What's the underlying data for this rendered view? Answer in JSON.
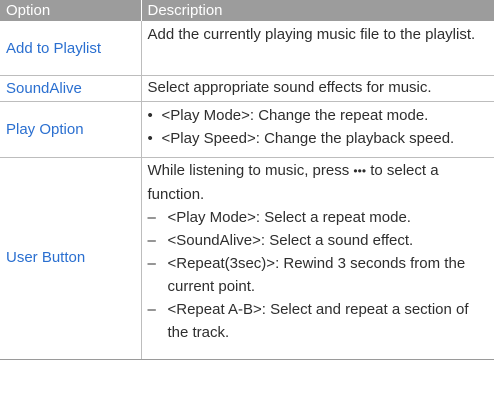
{
  "header": {
    "option": "Option",
    "description": "Description"
  },
  "rows": [
    {
      "option": "Add to Playlist",
      "description": "Add the currently playing music file to the playlist."
    },
    {
      "option": "SoundAlive",
      "description": "Select appropriate sound effects for music."
    },
    {
      "option": "Play Option",
      "bullets": [
        "<Play Mode>: Change the repeat mode.",
        "<Play Speed>: Change the playback speed."
      ]
    },
    {
      "option": "User Button",
      "intro_before_icon": "While listening to music, press",
      "icon_glyph": "•••",
      "intro_after_icon": "to select a function.",
      "dashes": [
        "<Play Mode>: Select a repeat mode.",
        "<SoundAlive>: Select a sound effect.",
        "<Repeat(3sec)>: Rewind 3 seconds from the current point.",
        "<Repeat A-B>: Select and repeat a section of the track."
      ]
    }
  ],
  "colors": {
    "header_bg": "#9c9c9c",
    "option_text": "#2a6fd0",
    "body_text": "#2e2e2e",
    "rule": "#bdbdbd"
  },
  "icons": {
    "more": "more-options-icon",
    "bullet": "bullet-icon",
    "dash": "dash-icon"
  }
}
